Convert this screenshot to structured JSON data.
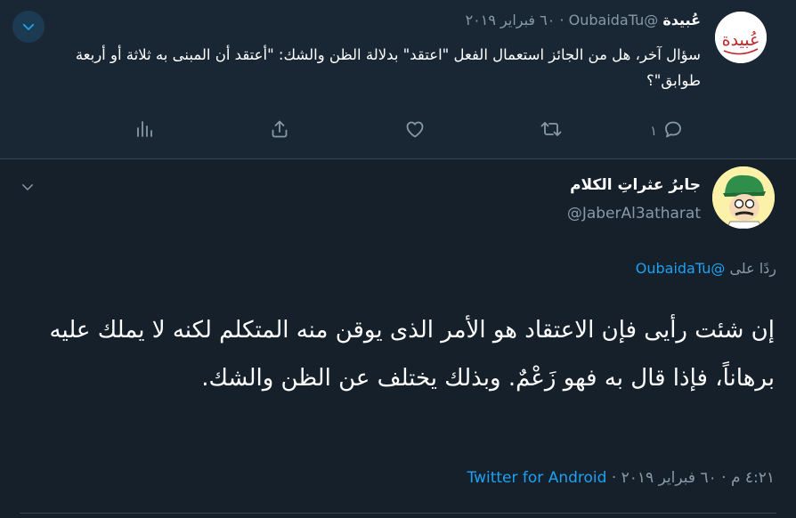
{
  "parent_tweet": {
    "author_name": "عُبيدة",
    "handle": "@OubaidaTu",
    "separator": "·",
    "date": "٦٠ فبراير ٢٠١٩",
    "text": "سؤال آخر، هل من الجائز استعمال الفعل \"اعتقد\" بدلالة الظن والشك: \"أعتقد أن المبنى به ثلاثة أو أربعة طوابق\"؟",
    "reply_count": "١",
    "icons": [
      "reply-icon",
      "retweet-icon",
      "like-icon",
      "share-icon",
      "stats-icon",
      "chevron-down-icon"
    ]
  },
  "main_tweet": {
    "author_name": "جابرُ عثراتِ الكلام",
    "handle": "@JaberAl3atharat",
    "reply_prefix": "ردًا على",
    "reply_to": "@OubaidaTu",
    "text": "إن شئت رأيى فإن الاعتقاد هو الأمر الذى يوقن منه المتكلم لكنه لا يملك عليه برهاناً، فإذا قال به فهو زَعْمٌ. وبذلك يختلف عن الظن والشك.",
    "time": "٤:٢١ م",
    "date": "٦٠ فبراير ٢٠١٩",
    "source": "Twitter for Android"
  },
  "avatar_text": "عُبيدة",
  "colors": {
    "background": "#15202b",
    "parent_background": "#192734",
    "link": "#1da1f2",
    "secondary_text": "#8899a6"
  }
}
